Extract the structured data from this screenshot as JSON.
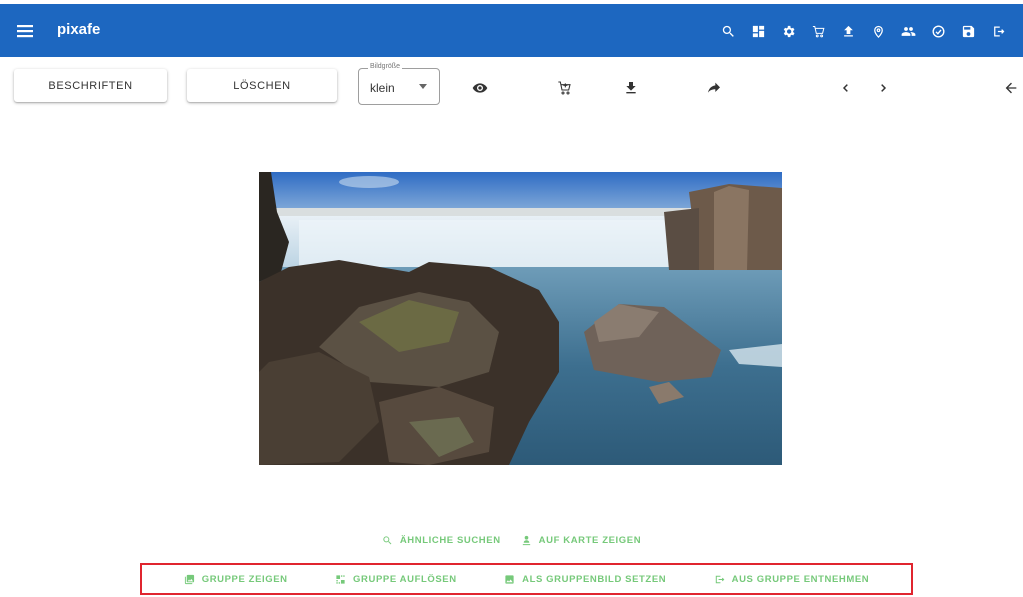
{
  "app": {
    "title": "pixafe"
  },
  "toolbar": {
    "beschriften_label": "BESCHRIFTEN",
    "loeschen_label": "LÖSCHEN",
    "size_legend": "Bildgröße",
    "size_value": "klein"
  },
  "top_icons": [
    "search-icon",
    "dashboard-icon",
    "settings-icon",
    "cart-icon",
    "upload-icon",
    "location-icon",
    "people-icon",
    "check-circle-icon",
    "save-icon",
    "logout-icon"
  ],
  "actions": {
    "similar_label": "ÄHNLICHE SUCHEN",
    "map_label": "AUF KARTE ZEIGEN"
  },
  "group_actions": {
    "show_label": "GRUPPE ZEIGEN",
    "dissolve_label": "GRUPPE AUFLÖSEN",
    "set_image_label": "ALS GRUPPENBILD SETZEN",
    "remove_label": "AUS GRUPPE ENTNEHMEN"
  },
  "colors": {
    "appbar": "#1d67c0",
    "action_text": "#76c97a",
    "highlight_border": "#e0252f"
  }
}
